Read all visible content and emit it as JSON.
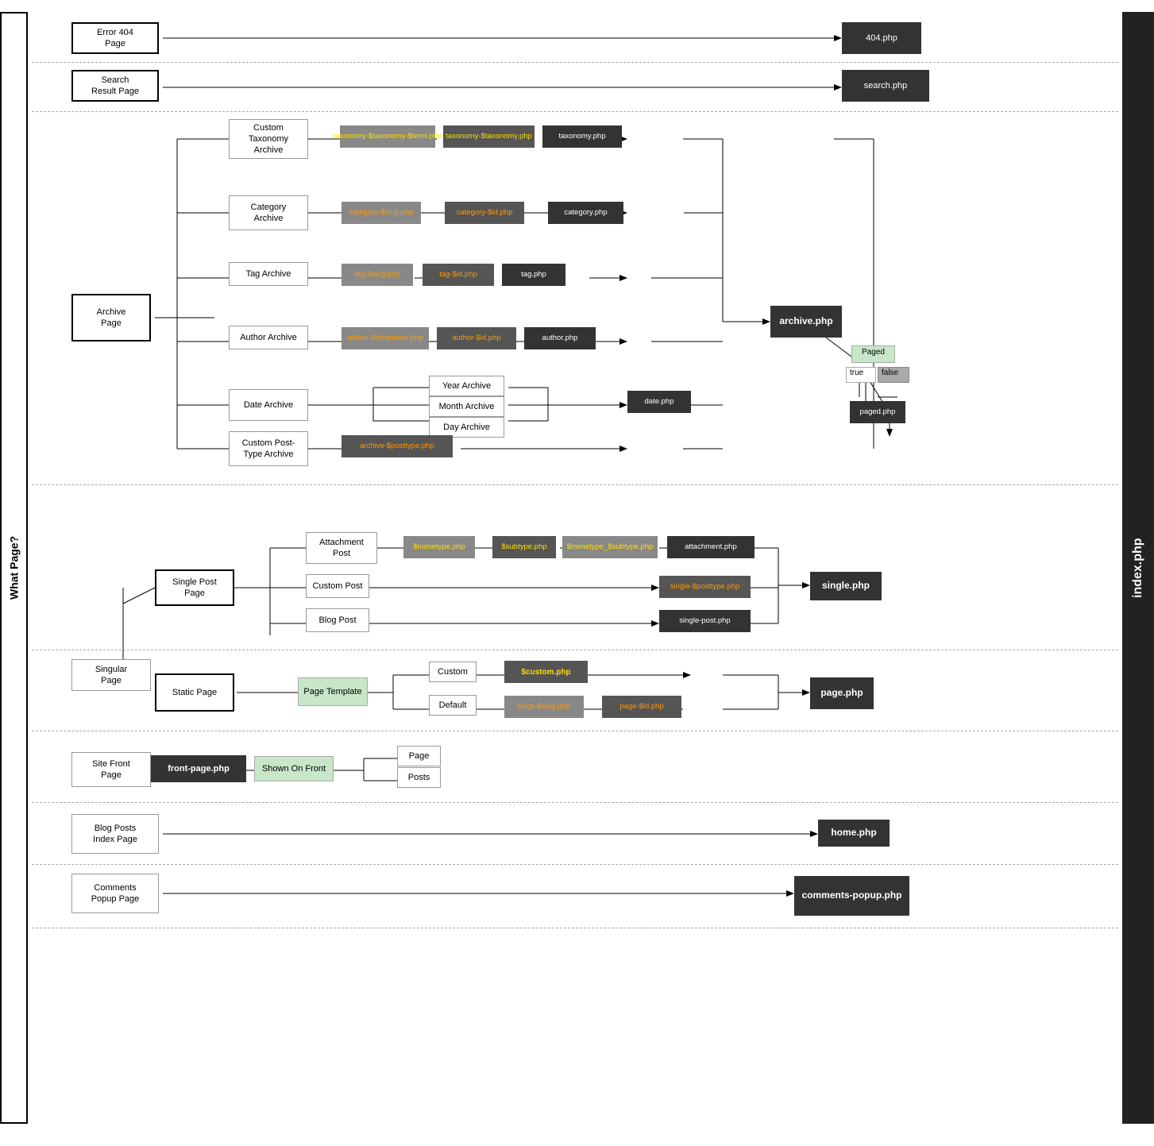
{
  "labels": {
    "what_page": "What Page?",
    "index_php": "index.php"
  },
  "sections": {
    "error404": {
      "left_label": "Error 404\nPage",
      "right_file": "404.php"
    },
    "search": {
      "left_label": "Search\nResult Page",
      "right_file": "search.php"
    },
    "archive": {
      "left_label": "Archive\nPage",
      "right_file": "archive.php",
      "sub_right": "date.php",
      "nodes": {
        "custom_taxonomy": "Custom\nTaxonomy\nArchive",
        "category": "Category\nArchive",
        "tag": "Tag Archive",
        "author": "Author Archive",
        "date": "Date Archive",
        "year_archive": "Year Archive",
        "month_archive": "Month Archive",
        "day_archive": "Day Archive",
        "custom_post_type": "Custom Post-\nType Archive"
      },
      "files": {
        "taxonomy_slug_term": "taxonomy-$taxonomy-$term.php",
        "taxonomy_slug": "taxonomy-$taxonomy.php",
        "taxonomy": "taxonomy.php",
        "category_slug": "category-$slug.php",
        "category_id": "category-$id.php",
        "category": "category.php",
        "tag_slug": "tag-$slug.php",
        "tag_id": "tag-$id.php",
        "tag": "tag.php",
        "author_nicename": "author-$nicename.php",
        "author_id": "author-$id.php",
        "author": "author.php",
        "date": "date.php",
        "archive_posttype": "archive-$posttype.php"
      }
    },
    "singular": {
      "left_label": "Singular\nPage",
      "single_post_page": "Single Post\nPage",
      "right_file": "single.php",
      "nodes": {
        "attachment": "Attachment\nPost",
        "custom_post": "Custom Post",
        "blog_post": "Blog Post"
      },
      "files": {
        "mimetype": "$mimetype.php",
        "subtype": "$subtype.php",
        "mimetype_subtype": "$mimetype_$subtype.php",
        "attachment": "attachment.php",
        "single_posttype": "single-$posttype.php",
        "single_post": "single-post.php"
      }
    },
    "static": {
      "left_label": "Static Page",
      "page_template": "Page Template",
      "right_file": "page.php",
      "nodes": {
        "custom": "Custom",
        "default": "Default"
      },
      "files": {
        "custom_php": "$custom.php",
        "page_slug": "page-$slug.php",
        "page_id": "page-$id.php"
      }
    },
    "front": {
      "left_label": "Site Front\nPage",
      "front_page_php": "front-page.php",
      "shown_on_front": "Shown On Front",
      "nodes": {
        "page": "Page",
        "posts": "Posts"
      }
    },
    "blog": {
      "left_label": "Blog Posts\nIndex Page",
      "right_file": "home.php"
    },
    "comments": {
      "left_label": "Comments\nPopup Page",
      "right_file": "comments-popup.php"
    }
  },
  "paged": {
    "label": "Paged",
    "true_label": "true",
    "false_label": "false",
    "file": "paged.php"
  }
}
